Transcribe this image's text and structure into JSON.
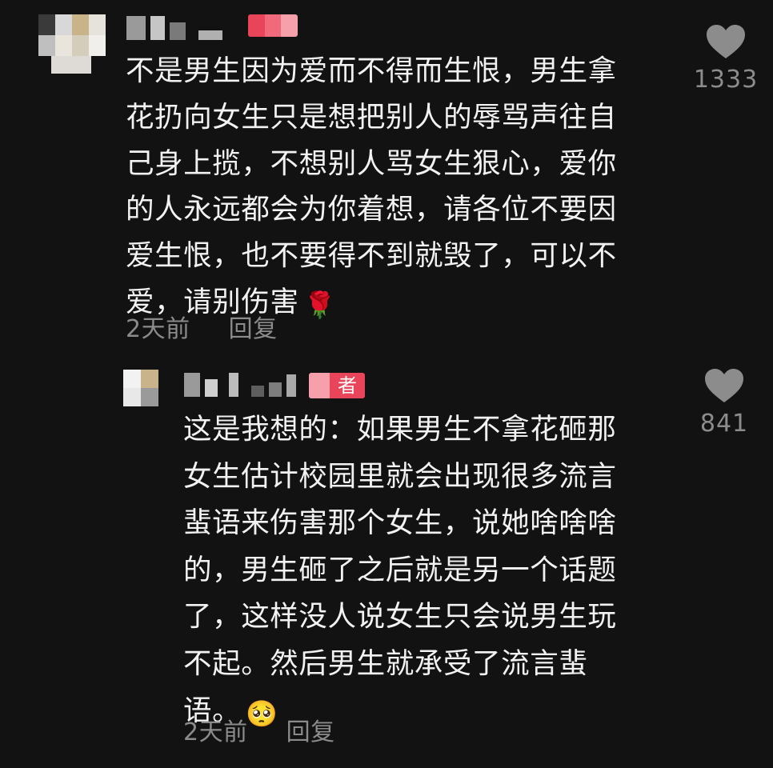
{
  "comments": [
    {
      "text_lines": [
        "不是男生因为爱而不得而生恨，男生拿",
        "花扔向女生只是想把别人的辱骂声往自",
        "己身上揽，不想别人骂女生狠心，爱你",
        "的人永远都会为你着想，请各位不要因",
        "爱生恨，也不要得不到就毁了，可以不",
        "爱，请别伤害"
      ],
      "emoji": "🌹",
      "time": "2天前",
      "reply_label": "回复",
      "like_count": "1333"
    },
    {
      "badge_text": "者",
      "text_lines": [
        "这是我想的：如果男生不拿花砸那",
        "女生估计校园里就会出现很多流言",
        "蜚语来伤害那个女生，说她啥啥啥",
        "的，男生砸了之后就是另一个话题",
        "了，这样没人说女生只会说男生玩",
        "不起。然后男生就承受了流言蜚",
        "语。"
      ],
      "emoji": "🥺",
      "time": "2天前",
      "reply_label": "回复",
      "like_count": "841"
    }
  ],
  "colors": {
    "background": "#121212",
    "text": "#f2f2f2",
    "meta": "#8b8b8b",
    "like_icon": "#8c8c8c",
    "badge_pink": "#e8445a"
  }
}
